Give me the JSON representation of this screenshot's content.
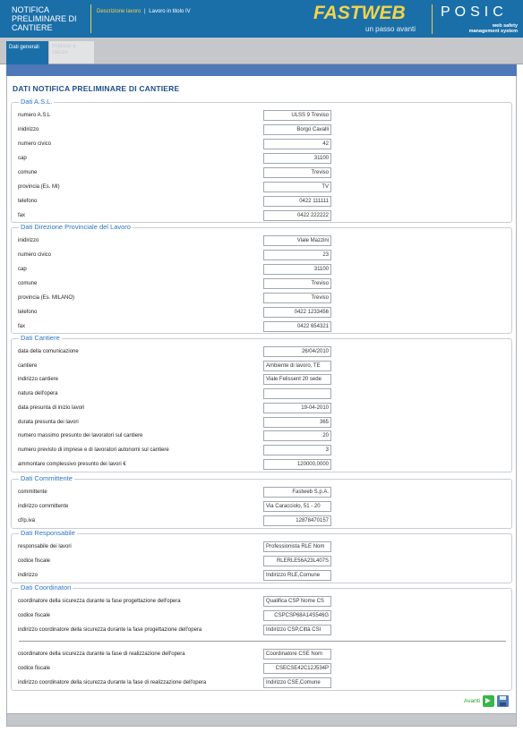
{
  "header": {
    "app_title": "NOTIFICA PRELIMINARE DI CANTIERE",
    "breadcrumb": {
      "active": "Descrizione lavoro",
      "separator": "|",
      "current": "Lavoro in titolo IV"
    },
    "brand": "FASTWEB",
    "brand_tagline": "un passo avanti",
    "product": "POSIC",
    "product_sub_line1": "web safety",
    "product_sub_line2": "management system",
    "colors": {
      "header_bg": "#1b6fa9",
      "accent": "#f3d44a"
    }
  },
  "tabs": [
    {
      "label": "Dati generali",
      "active": true
    },
    {
      "label": "Imprese e utenze",
      "active": false
    }
  ],
  "page_title": "DATI NOTIFICA PRELIMINARE DI CANTIERE",
  "sections": {
    "asl": {
      "legend": "Dati A.S.L.",
      "rows": [
        {
          "label": "numero A.S.L",
          "value": "ULSS 9 Treviso"
        },
        {
          "label": "inidirizzo",
          "value": "Borgo Cavalli"
        },
        {
          "label": "numero civico",
          "value": "42"
        },
        {
          "label": "cap",
          "value": "31100"
        },
        {
          "label": "comune",
          "value": "Treviso"
        },
        {
          "label": "provincia (Es. MI)",
          "value": "TV"
        },
        {
          "label": "telefono",
          "value": "0422 111111"
        },
        {
          "label": "fax",
          "value": "0422 222222"
        }
      ]
    },
    "dpl": {
      "legend": "Dati Direzione Provinciale del Lavoro",
      "rows": [
        {
          "label": "inidirizzo",
          "value": "Viale Mazzini"
        },
        {
          "label": "numero civico",
          "value": "23"
        },
        {
          "label": "cap",
          "value": "31100"
        },
        {
          "label": "comune",
          "value": "Treviso"
        },
        {
          "label": "provincia (Es. MILANO)",
          "value": "Treviso"
        },
        {
          "label": "telefono",
          "value": "0422 1233456"
        },
        {
          "label": "fax",
          "value": "0422 654321"
        }
      ]
    },
    "cantiere": {
      "legend": "Dati Cantiere",
      "rows": [
        {
          "label": "data della comunicazione",
          "value": "26/04/2010"
        },
        {
          "label": "cantiere",
          "value": "Ambiente di lavoro, TE"
        },
        {
          "label": "indirizzo cantiere",
          "value": "Viale Felissent 20 sede"
        },
        {
          "label": "natura dell'opera",
          "value": ""
        },
        {
          "label": "data presunta di inizio lavori",
          "value": "19-04-2010"
        },
        {
          "label": "durata presunta dei lavori",
          "value": "365"
        },
        {
          "label": "numero massimo presunto dei lavoratori sul cantiere",
          "value": "20"
        },
        {
          "label": "numero previsto di imprese e di lavoratori autonomi sul cantiere",
          "value": "3"
        },
        {
          "label": "ammontare complessivo presunto dei lavori €",
          "value": "120000,0000"
        }
      ]
    },
    "committente": {
      "legend": "Dati Committente",
      "rows": [
        {
          "label": "committente",
          "value": "Fastweb S.p.A."
        },
        {
          "label": "indirizzo committente",
          "value": "Via Caracciolo, 51 - 20"
        },
        {
          "label": "cf/p.iva",
          "value": "12878470157"
        }
      ]
    },
    "responsabile": {
      "legend": "Dati Responsabile",
      "rows": [
        {
          "label": "responsabile dei lavori",
          "value": "Professionista RLE Nom"
        },
        {
          "label": "codice fiscale",
          "value": "RLERLE56A23L407S"
        },
        {
          "label": "indirizzo",
          "value": "Indirizzo RLE,Comune"
        }
      ]
    },
    "coordinatori": {
      "legend": "Dati Coordinatori",
      "rows": [
        {
          "label": "coordinatore della sicurezza durante la fase progettazione dell'opera",
          "value": "Qualifica CSP Nome CS"
        },
        {
          "label": "codice fiscale",
          "value": "CSPCSP68A14S546G"
        },
        {
          "label": "indirizzo coordinatore della sicurezza durante la fase progettazione dell'opera",
          "value": "Indirizzo CSP,Città CSI"
        },
        {
          "label": "coordinatore della sicurezza durante la fase di realizzazione dell'opera",
          "value": "Coordinatore CSE Nom"
        },
        {
          "label": "codice fiscale",
          "value": "CSECSE42C12J534P"
        },
        {
          "label": "indirizzo coordinatore della sicurezza durante la fase di realizzazione dell'opera",
          "value": "Indirizzo CSE,Comune"
        }
      ]
    }
  },
  "footer": {
    "next_label": "Avanti"
  }
}
